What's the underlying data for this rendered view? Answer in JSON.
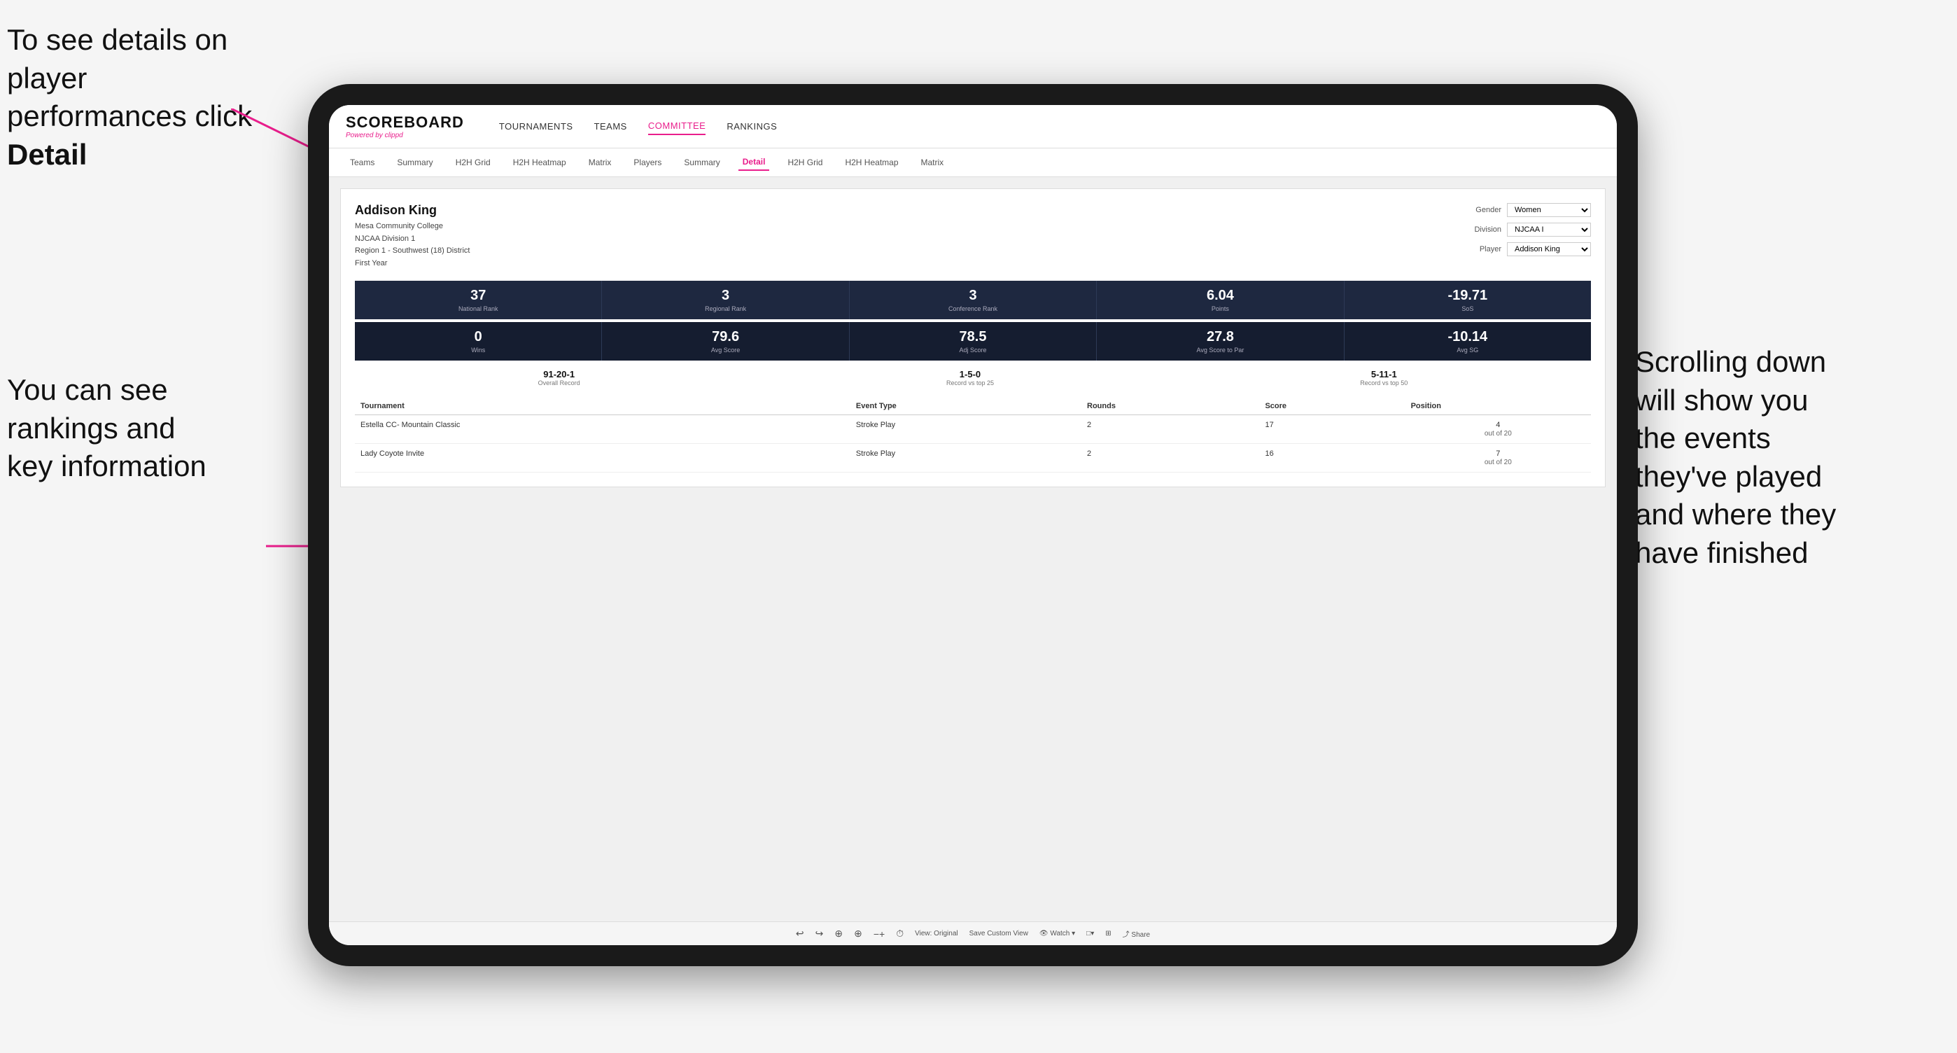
{
  "annotations": {
    "top_left": "To see details on player performances click ",
    "top_left_bold": "Detail",
    "bottom_left_line1": "You can see",
    "bottom_left_line2": "rankings and",
    "bottom_left_line3": "key information",
    "right_line1": "Scrolling down",
    "right_line2": "will show you",
    "right_line3": "the events",
    "right_line4": "they've played",
    "right_line5": "and where they",
    "right_line6": "have finished"
  },
  "nav": {
    "logo": "SCOREBOARD",
    "logo_sub": "Powered by ",
    "logo_sub_brand": "clippd",
    "items": [
      "TOURNAMENTS",
      "TEAMS",
      "COMMITTEE",
      "RANKINGS"
    ]
  },
  "sub_nav": {
    "items": [
      "Teams",
      "Summary",
      "H2H Grid",
      "H2H Heatmap",
      "Matrix",
      "Players",
      "Summary",
      "Detail",
      "H2H Grid",
      "H2H Heatmap",
      "Matrix"
    ],
    "active": "Detail"
  },
  "player": {
    "name": "Addison King",
    "college": "Mesa Community College",
    "division": "NJCAA Division 1",
    "region": "Region 1 - Southwest (18) District",
    "year": "First Year"
  },
  "filters": {
    "gender_label": "Gender",
    "gender_value": "Women",
    "division_label": "Division",
    "division_value": "NJCAA I",
    "player_label": "Player",
    "player_value": "Addison King"
  },
  "stats_row1": [
    {
      "value": "37",
      "label": "National Rank"
    },
    {
      "value": "3",
      "label": "Regional Rank"
    },
    {
      "value": "3",
      "label": "Conference Rank"
    },
    {
      "value": "6.04",
      "label": "Points"
    },
    {
      "value": "-19.71",
      "label": "SoS"
    }
  ],
  "stats_row2": [
    {
      "value": "0",
      "label": "Wins"
    },
    {
      "value": "79.6",
      "label": "Avg Score"
    },
    {
      "value": "78.5",
      "label": "Adj Score"
    },
    {
      "value": "27.8",
      "label": "Avg Score to Par"
    },
    {
      "value": "-10.14",
      "label": "Avg SG"
    }
  ],
  "records": [
    {
      "value": "91-20-1",
      "label": "Overall Record"
    },
    {
      "value": "1-5-0",
      "label": "Record vs top 25"
    },
    {
      "value": "5-11-1",
      "label": "Record vs top 50"
    }
  ],
  "table": {
    "headers": [
      "Tournament",
      "Event Type",
      "Rounds",
      "Score",
      "Position"
    ],
    "rows": [
      {
        "tournament": "Estella CC- Mountain Classic",
        "event_type": "Stroke Play",
        "rounds": "2",
        "score": "17",
        "position": "4\nout of 20"
      },
      {
        "tournament": "Lady Coyote Invite",
        "event_type": "Stroke Play",
        "rounds": "2",
        "score": "16",
        "position": "7\nout of 20"
      }
    ]
  },
  "toolbar": {
    "items": [
      "↩",
      "↪",
      "⊕",
      "⊕",
      "−+",
      "⏱",
      "View: Original",
      "Save Custom View",
      "Watch ▾",
      "□▾",
      "⊞",
      "Share"
    ]
  }
}
